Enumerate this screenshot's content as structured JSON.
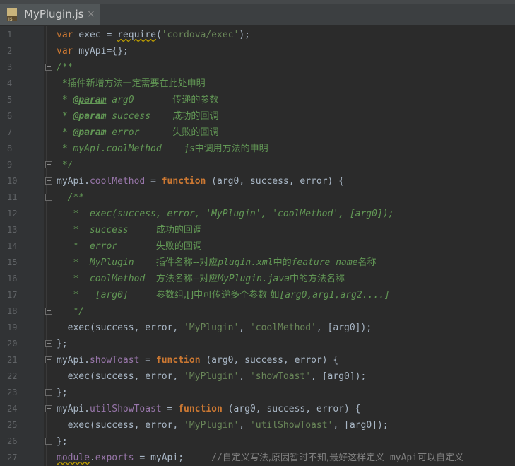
{
  "tab": {
    "title": "MyPlugin.js",
    "close": "×",
    "icon": "js-file-icon"
  },
  "lines": [
    [
      {
        "t": "var",
        "c": "kwn"
      },
      {
        "t": " exec = "
      },
      {
        "t": "require",
        "c": "und"
      },
      {
        "t": "("
      },
      {
        "t": "'cordova/exec'",
        "c": "str"
      },
      {
        "t": ");"
      }
    ],
    [
      {
        "t": "var",
        "c": "kwn"
      },
      {
        "t": " myApi={};"
      }
    ],
    [
      {
        "t": "/**",
        "c": "cmt"
      }
    ],
    [
      {
        "t": " *",
        "c": "cmt"
      },
      {
        "t": "插件新增方法一定需要在此处申明",
        "c": "cmt cn"
      }
    ],
    [
      {
        "t": " * ",
        "c": "cmt"
      },
      {
        "t": "@param",
        "c": "tag"
      },
      {
        "t": " arg0       ",
        "c": "cmt"
      },
      {
        "t": "传递的参数",
        "c": "cmt cn"
      }
    ],
    [
      {
        "t": " * ",
        "c": "cmt"
      },
      {
        "t": "@param",
        "c": "tag"
      },
      {
        "t": " success    ",
        "c": "cmt"
      },
      {
        "t": "成功的回调",
        "c": "cmt cn"
      }
    ],
    [
      {
        "t": " * ",
        "c": "cmt"
      },
      {
        "t": "@param",
        "c": "tag"
      },
      {
        "t": " error      ",
        "c": "cmt"
      },
      {
        "t": "失败的回调",
        "c": "cmt cn"
      }
    ],
    [
      {
        "t": " * myApi.coolMethod    js",
        "c": "cmt"
      },
      {
        "t": "中调用方法的申明",
        "c": "cmt cn"
      }
    ],
    [
      {
        "t": " */",
        "c": "cmt"
      }
    ],
    [
      {
        "t": "myApi."
      },
      {
        "t": "coolMethod",
        "c": "prop"
      },
      {
        "t": " = "
      },
      {
        "t": "function",
        "c": "kw"
      },
      {
        "t": " (arg0, success, error) {"
      }
    ],
    [
      {
        "t": "  /**",
        "c": "cmt"
      }
    ],
    [
      {
        "t": "   *  exec(success, error, 'MyPlugin', 'coolMethod', [arg0]);",
        "c": "cmt"
      }
    ],
    [
      {
        "t": "   *  success     ",
        "c": "cmt"
      },
      {
        "t": "成功的回调",
        "c": "cmt cn"
      }
    ],
    [
      {
        "t": "   *  error       ",
        "c": "cmt"
      },
      {
        "t": "失败的回调",
        "c": "cmt cn"
      }
    ],
    [
      {
        "t": "   *  MyPlugin    ",
        "c": "cmt"
      },
      {
        "t": "插件名称--对应",
        "c": "cmt cn"
      },
      {
        "t": "plugin.xml",
        "c": "cmt"
      },
      {
        "t": "中的",
        "c": "cmt cn"
      },
      {
        "t": "feature name",
        "c": "cmt"
      },
      {
        "t": "名称",
        "c": "cmt cn"
      }
    ],
    [
      {
        "t": "   *  coolMethod  ",
        "c": "cmt"
      },
      {
        "t": "方法名称--对应",
        "c": "cmt cn"
      },
      {
        "t": "MyPlugin.java",
        "c": "cmt"
      },
      {
        "t": "中的方法名称",
        "c": "cmt cn"
      }
    ],
    [
      {
        "t": "   *   [arg0]     ",
        "c": "cmt"
      },
      {
        "t": "参数组,[]中可传递多个参数 如",
        "c": "cmt cn"
      },
      {
        "t": "[arg0,arg1,arg2....]",
        "c": "cmt"
      }
    ],
    [
      {
        "t": "   */",
        "c": "cmt"
      }
    ],
    [
      {
        "t": "  exec(success, error, "
      },
      {
        "t": "'MyPlugin'",
        "c": "str"
      },
      {
        "t": ", "
      },
      {
        "t": "'coolMethod'",
        "c": "str"
      },
      {
        "t": ", [arg0]);"
      }
    ],
    [
      {
        "t": "};"
      }
    ],
    [
      {
        "t": "myApi."
      },
      {
        "t": "showToast",
        "c": "prop"
      },
      {
        "t": " = "
      },
      {
        "t": "function",
        "c": "kw"
      },
      {
        "t": " (arg0, success, error) {"
      }
    ],
    [
      {
        "t": "  exec(success, error, "
      },
      {
        "t": "'MyPlugin'",
        "c": "str"
      },
      {
        "t": ", "
      },
      {
        "t": "'showToast'",
        "c": "str"
      },
      {
        "t": ", [arg0]);"
      }
    ],
    [
      {
        "t": "};"
      }
    ],
    [
      {
        "t": "myApi."
      },
      {
        "t": "utilShowToast",
        "c": "prop"
      },
      {
        "t": " = "
      },
      {
        "t": "function",
        "c": "kw"
      },
      {
        "t": " (arg0, success, error) {"
      }
    ],
    [
      {
        "t": "  exec(success, error, "
      },
      {
        "t": "'MyPlugin'",
        "c": "str"
      },
      {
        "t": ", "
      },
      {
        "t": "'utilShowToast'",
        "c": "str"
      },
      {
        "t": ", [arg0]);"
      }
    ],
    [
      {
        "t": "};"
      }
    ],
    [
      {
        "t": "module",
        "c": "prop und"
      },
      {
        "t": "."
      },
      {
        "t": "exports",
        "c": "prop"
      },
      {
        "t": " = myApi;     "
      },
      {
        "t": "//",
        "c": "lc"
      },
      {
        "t": "自定义写法,原因暂时不知,最好这样定义",
        "c": "lc cn"
      },
      {
        "t": " myApi",
        "c": "lc"
      },
      {
        "t": "可以自定义",
        "c": "lc cn"
      }
    ]
  ],
  "line_numbers": [
    "1",
    "2",
    "3",
    "4",
    "5",
    "6",
    "7",
    "8",
    "9",
    "10",
    "11",
    "12",
    "13",
    "14",
    "15",
    "16",
    "17",
    "18",
    "19",
    "20",
    "21",
    "22",
    "23",
    "24",
    "25",
    "26",
    "27"
  ],
  "fold_markers": [
    {
      "line": 3,
      "kind": "top"
    },
    {
      "line": 9,
      "kind": "bot"
    },
    {
      "line": 10,
      "kind": "top"
    },
    {
      "line": 11,
      "kind": "top"
    },
    {
      "line": 18,
      "kind": "bot"
    },
    {
      "line": 20,
      "kind": "bot"
    },
    {
      "line": 21,
      "kind": "top"
    },
    {
      "line": 23,
      "kind": "bot"
    },
    {
      "line": 24,
      "kind": "top"
    },
    {
      "line": 26,
      "kind": "bot"
    }
  ]
}
